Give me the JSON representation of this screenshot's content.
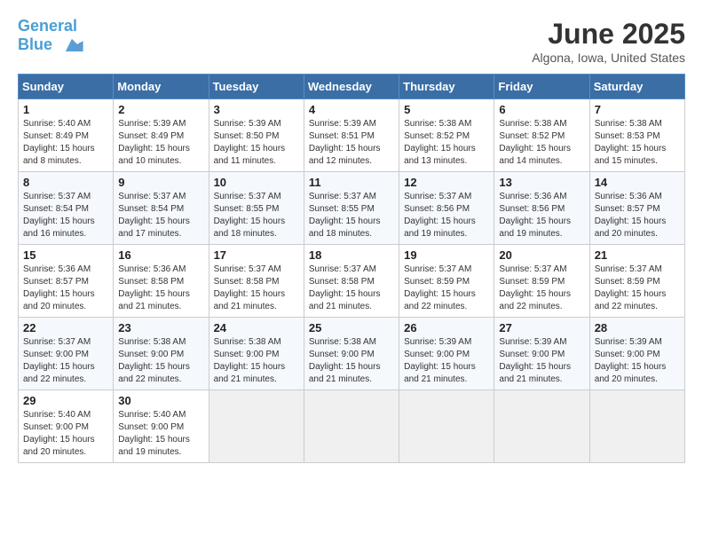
{
  "header": {
    "logo_line1": "General",
    "logo_line2": "Blue",
    "month_title": "June 2025",
    "location": "Algona, Iowa, United States"
  },
  "weekdays": [
    "Sunday",
    "Monday",
    "Tuesday",
    "Wednesday",
    "Thursday",
    "Friday",
    "Saturday"
  ],
  "weeks": [
    [
      {
        "day": "1",
        "info": "Sunrise: 5:40 AM\nSunset: 8:49 PM\nDaylight: 15 hours\nand 8 minutes."
      },
      {
        "day": "2",
        "info": "Sunrise: 5:39 AM\nSunset: 8:49 PM\nDaylight: 15 hours\nand 10 minutes."
      },
      {
        "day": "3",
        "info": "Sunrise: 5:39 AM\nSunset: 8:50 PM\nDaylight: 15 hours\nand 11 minutes."
      },
      {
        "day": "4",
        "info": "Sunrise: 5:39 AM\nSunset: 8:51 PM\nDaylight: 15 hours\nand 12 minutes."
      },
      {
        "day": "5",
        "info": "Sunrise: 5:38 AM\nSunset: 8:52 PM\nDaylight: 15 hours\nand 13 minutes."
      },
      {
        "day": "6",
        "info": "Sunrise: 5:38 AM\nSunset: 8:52 PM\nDaylight: 15 hours\nand 14 minutes."
      },
      {
        "day": "7",
        "info": "Sunrise: 5:38 AM\nSunset: 8:53 PM\nDaylight: 15 hours\nand 15 minutes."
      }
    ],
    [
      {
        "day": "8",
        "info": "Sunrise: 5:37 AM\nSunset: 8:54 PM\nDaylight: 15 hours\nand 16 minutes."
      },
      {
        "day": "9",
        "info": "Sunrise: 5:37 AM\nSunset: 8:54 PM\nDaylight: 15 hours\nand 17 minutes."
      },
      {
        "day": "10",
        "info": "Sunrise: 5:37 AM\nSunset: 8:55 PM\nDaylight: 15 hours\nand 18 minutes."
      },
      {
        "day": "11",
        "info": "Sunrise: 5:37 AM\nSunset: 8:55 PM\nDaylight: 15 hours\nand 18 minutes."
      },
      {
        "day": "12",
        "info": "Sunrise: 5:37 AM\nSunset: 8:56 PM\nDaylight: 15 hours\nand 19 minutes."
      },
      {
        "day": "13",
        "info": "Sunrise: 5:36 AM\nSunset: 8:56 PM\nDaylight: 15 hours\nand 19 minutes."
      },
      {
        "day": "14",
        "info": "Sunrise: 5:36 AM\nSunset: 8:57 PM\nDaylight: 15 hours\nand 20 minutes."
      }
    ],
    [
      {
        "day": "15",
        "info": "Sunrise: 5:36 AM\nSunset: 8:57 PM\nDaylight: 15 hours\nand 20 minutes."
      },
      {
        "day": "16",
        "info": "Sunrise: 5:36 AM\nSunset: 8:58 PM\nDaylight: 15 hours\nand 21 minutes."
      },
      {
        "day": "17",
        "info": "Sunrise: 5:37 AM\nSunset: 8:58 PM\nDaylight: 15 hours\nand 21 minutes."
      },
      {
        "day": "18",
        "info": "Sunrise: 5:37 AM\nSunset: 8:58 PM\nDaylight: 15 hours\nand 21 minutes."
      },
      {
        "day": "19",
        "info": "Sunrise: 5:37 AM\nSunset: 8:59 PM\nDaylight: 15 hours\nand 22 minutes."
      },
      {
        "day": "20",
        "info": "Sunrise: 5:37 AM\nSunset: 8:59 PM\nDaylight: 15 hours\nand 22 minutes."
      },
      {
        "day": "21",
        "info": "Sunrise: 5:37 AM\nSunset: 8:59 PM\nDaylight: 15 hours\nand 22 minutes."
      }
    ],
    [
      {
        "day": "22",
        "info": "Sunrise: 5:37 AM\nSunset: 9:00 PM\nDaylight: 15 hours\nand 22 minutes."
      },
      {
        "day": "23",
        "info": "Sunrise: 5:38 AM\nSunset: 9:00 PM\nDaylight: 15 hours\nand 22 minutes."
      },
      {
        "day": "24",
        "info": "Sunrise: 5:38 AM\nSunset: 9:00 PM\nDaylight: 15 hours\nand 21 minutes."
      },
      {
        "day": "25",
        "info": "Sunrise: 5:38 AM\nSunset: 9:00 PM\nDaylight: 15 hours\nand 21 minutes."
      },
      {
        "day": "26",
        "info": "Sunrise: 5:39 AM\nSunset: 9:00 PM\nDaylight: 15 hours\nand 21 minutes."
      },
      {
        "day": "27",
        "info": "Sunrise: 5:39 AM\nSunset: 9:00 PM\nDaylight: 15 hours\nand 21 minutes."
      },
      {
        "day": "28",
        "info": "Sunrise: 5:39 AM\nSunset: 9:00 PM\nDaylight: 15 hours\nand 20 minutes."
      }
    ],
    [
      {
        "day": "29",
        "info": "Sunrise: 5:40 AM\nSunset: 9:00 PM\nDaylight: 15 hours\nand 20 minutes."
      },
      {
        "day": "30",
        "info": "Sunrise: 5:40 AM\nSunset: 9:00 PM\nDaylight: 15 hours\nand 19 minutes."
      },
      {
        "day": "",
        "info": ""
      },
      {
        "day": "",
        "info": ""
      },
      {
        "day": "",
        "info": ""
      },
      {
        "day": "",
        "info": ""
      },
      {
        "day": "",
        "info": ""
      }
    ]
  ]
}
